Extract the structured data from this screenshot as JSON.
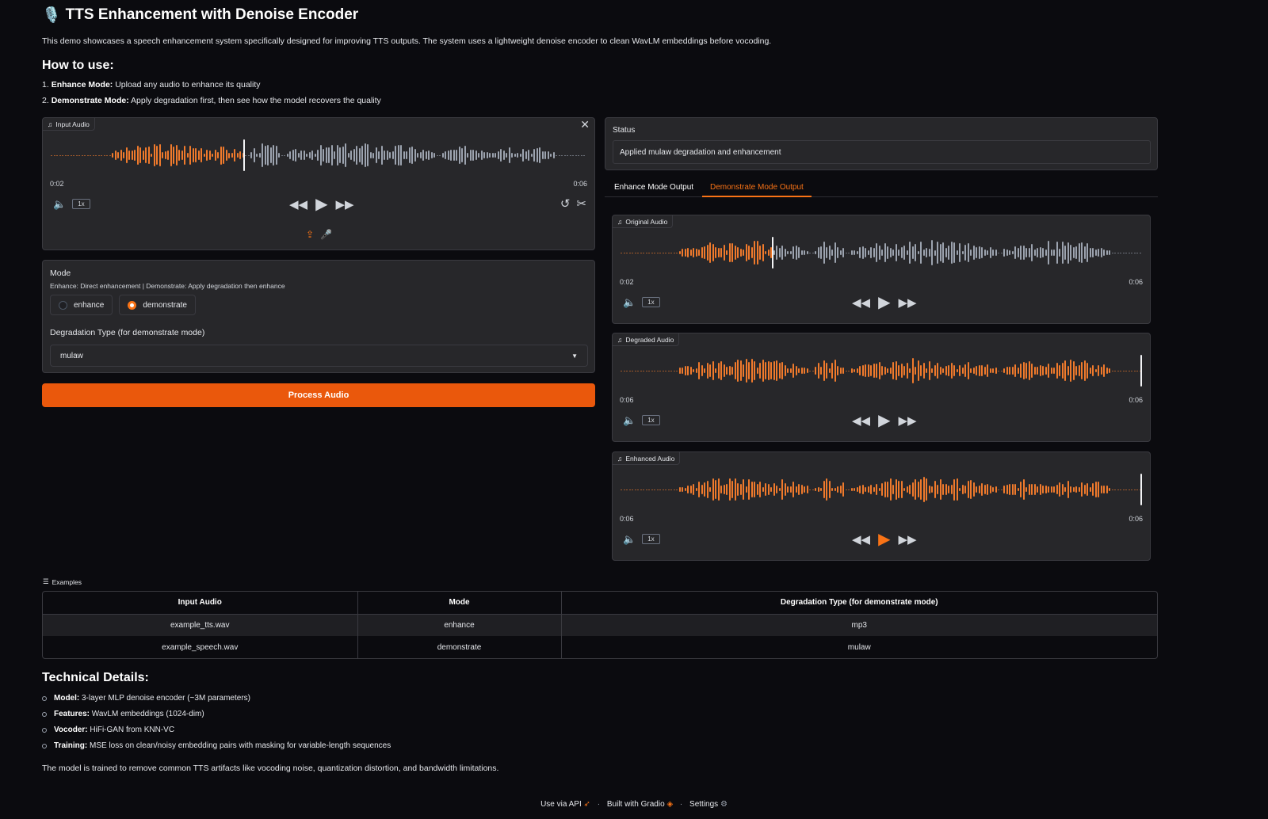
{
  "header": {
    "title_icon": "🎙️",
    "title": "TTS Enhancement with Denoise Encoder",
    "description": "This demo showcases a speech enhancement system specifically designed for improving TTS outputs. The system uses a lightweight denoise encoder to clean WavLM embeddings before vocoding.",
    "how_to_heading": "How to use:",
    "steps": [
      {
        "num": "1.",
        "bold": "Enhance Mode:",
        "text": "Upload any audio to enhance its quality"
      },
      {
        "num": "2.",
        "bold": "Demonstrate Mode:",
        "text": "Apply degradation first, then see how the model recovers the quality"
      }
    ]
  },
  "input_audio": {
    "label": "Input Audio",
    "current_time": "0:02",
    "duration": "0:06",
    "rate": "1x",
    "progress": 0.36
  },
  "mode": {
    "label": "Mode",
    "info": "Enhance: Direct enhancement | Demonstrate: Apply degradation then enhance",
    "options": [
      "enhance",
      "demonstrate"
    ],
    "selected": "demonstrate"
  },
  "degradation": {
    "label": "Degradation Type (for demonstrate mode)",
    "value": "mulaw"
  },
  "process_button": "Process Audio",
  "status": {
    "label": "Status",
    "value": "Applied mulaw degradation and enhancement"
  },
  "tabs": [
    "Enhance Mode Output",
    "Demonstrate Mode Output"
  ],
  "active_tab": "Demonstrate Mode Output",
  "outputs": [
    {
      "label": "Original Audio",
      "current_time": "0:02",
      "duration": "0:06",
      "rate": "1x",
      "progress": 0.29
    },
    {
      "label": "Degraded Audio",
      "current_time": "0:06",
      "duration": "0:06",
      "rate": "1x",
      "progress": 1.0
    },
    {
      "label": "Enhanced Audio",
      "current_time": "0:06",
      "duration": "0:06",
      "rate": "1x",
      "progress": 1.0
    }
  ],
  "examples": {
    "label": "Examples",
    "headers": [
      "Input Audio",
      "Mode",
      "Degradation Type (for demonstrate mode)"
    ],
    "rows": [
      [
        "example_tts.wav",
        "enhance",
        "mp3"
      ],
      [
        "example_speech.wav",
        "demonstrate",
        "mulaw"
      ]
    ]
  },
  "technical": {
    "heading": "Technical Details:",
    "items": [
      {
        "bold": "Model:",
        "text": "3-layer MLP denoise encoder (~3M parameters)"
      },
      {
        "bold": "Features:",
        "text": "WavLM embeddings (1024-dim)"
      },
      {
        "bold": "Vocoder:",
        "text": "HiFi-GAN from KNN-VC"
      },
      {
        "bold": "Training:",
        "text": "MSE loss on clean/noisy embedding pairs with masking for variable-length sequences"
      }
    ],
    "note": "The model is trained to remove common TTS artifacts like vocoding noise, quantization distortion, and bandwidth limitations."
  },
  "footer": {
    "api": "Use via API",
    "built": "Built with Gradio",
    "settings": "Settings",
    "sep": "·"
  },
  "colors": {
    "accent": "#ea580c",
    "accent_light": "#f97316",
    "played": "#f07a2c",
    "unplayed": "#9ca3af"
  }
}
